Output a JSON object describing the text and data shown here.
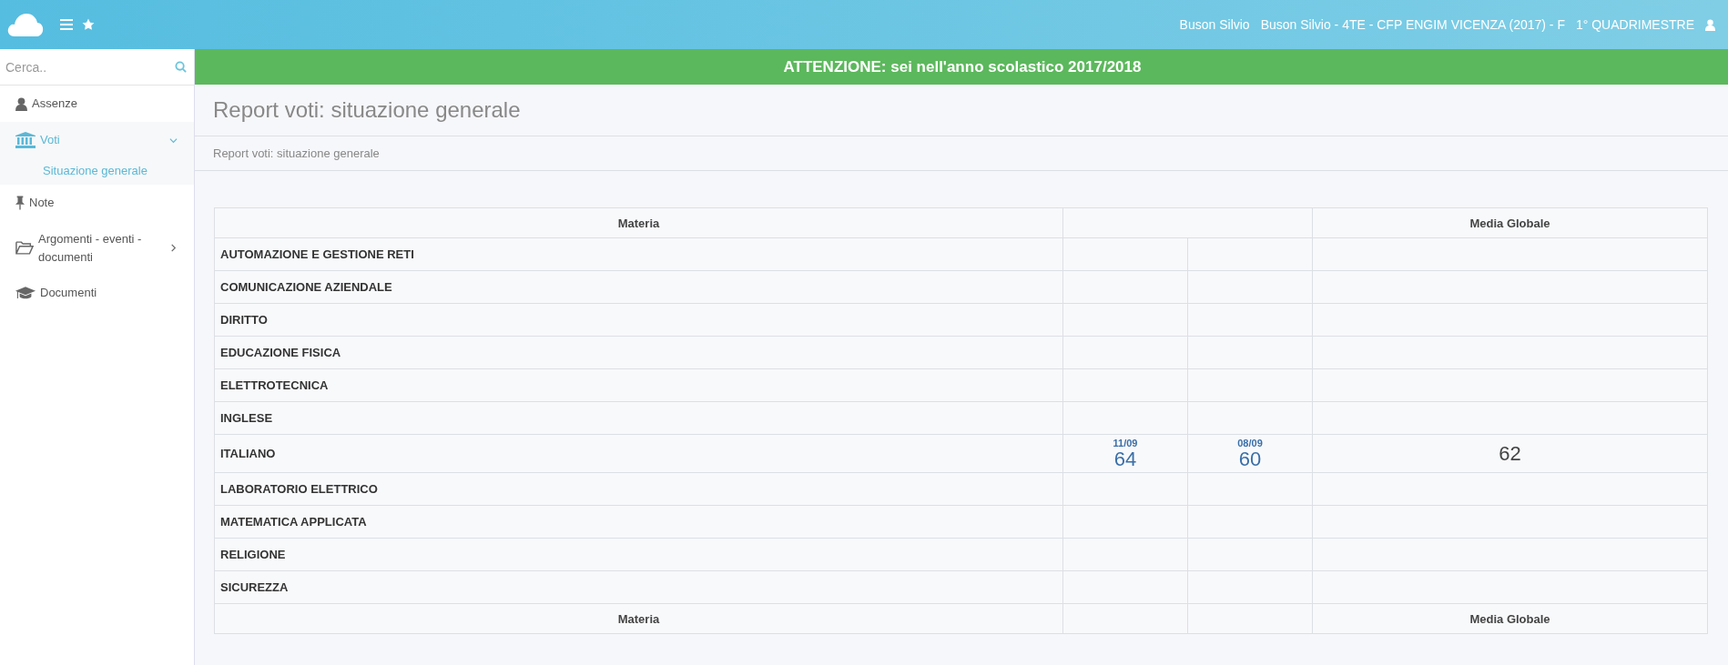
{
  "topbar": {
    "user_name": "Buson Silvio",
    "class_info": "Buson Silvio - 4TE - CFP ENGIM VICENZA (2017) - F",
    "period": "1° QUADRIMESTRE"
  },
  "sidebar": {
    "search": {
      "placeholder": "Cerca.."
    },
    "items": [
      {
        "label": "Assenze",
        "selected": false
      },
      {
        "label": "Voti",
        "selected": true,
        "expanded": true,
        "children": [
          {
            "label": "Situazione generale",
            "selected": true
          }
        ]
      },
      {
        "label": "Note",
        "selected": false
      },
      {
        "label": "Argomenti - eventi - documenti",
        "selected": false,
        "expanded": false
      },
      {
        "label": "Documenti",
        "selected": false
      }
    ]
  },
  "banner": "ATTENZIONE: sei nell'anno scolastico 2017/2018",
  "page_title": "Report voti: situazione generale",
  "breadcrumb": "Report voti: situazione generale",
  "table": {
    "header": {
      "subject": "Materia",
      "average": "Media Globale"
    },
    "rows": [
      {
        "subject": "AUTOMAZIONE E GESTIONE RETI"
      },
      {
        "subject": "COMUNICAZIONE AZIENDALE"
      },
      {
        "subject": "DIRITTO"
      },
      {
        "subject": "EDUCAZIONE FISICA"
      },
      {
        "subject": "ELETTROTECNICA"
      },
      {
        "subject": "INGLESE"
      },
      {
        "subject": "ITALIANO",
        "grades": [
          {
            "date": "11/09",
            "value": "64"
          },
          {
            "date": "08/09",
            "value": "60"
          }
        ],
        "average": "62"
      },
      {
        "subject": "LABORATORIO ELETTRICO"
      },
      {
        "subject": "MATEMATICA APPLICATA"
      },
      {
        "subject": "RELIGIONE"
      },
      {
        "subject": "SICUREZZA"
      }
    ],
    "footer": {
      "subject": "Materia",
      "average": "Media Globale"
    }
  }
}
